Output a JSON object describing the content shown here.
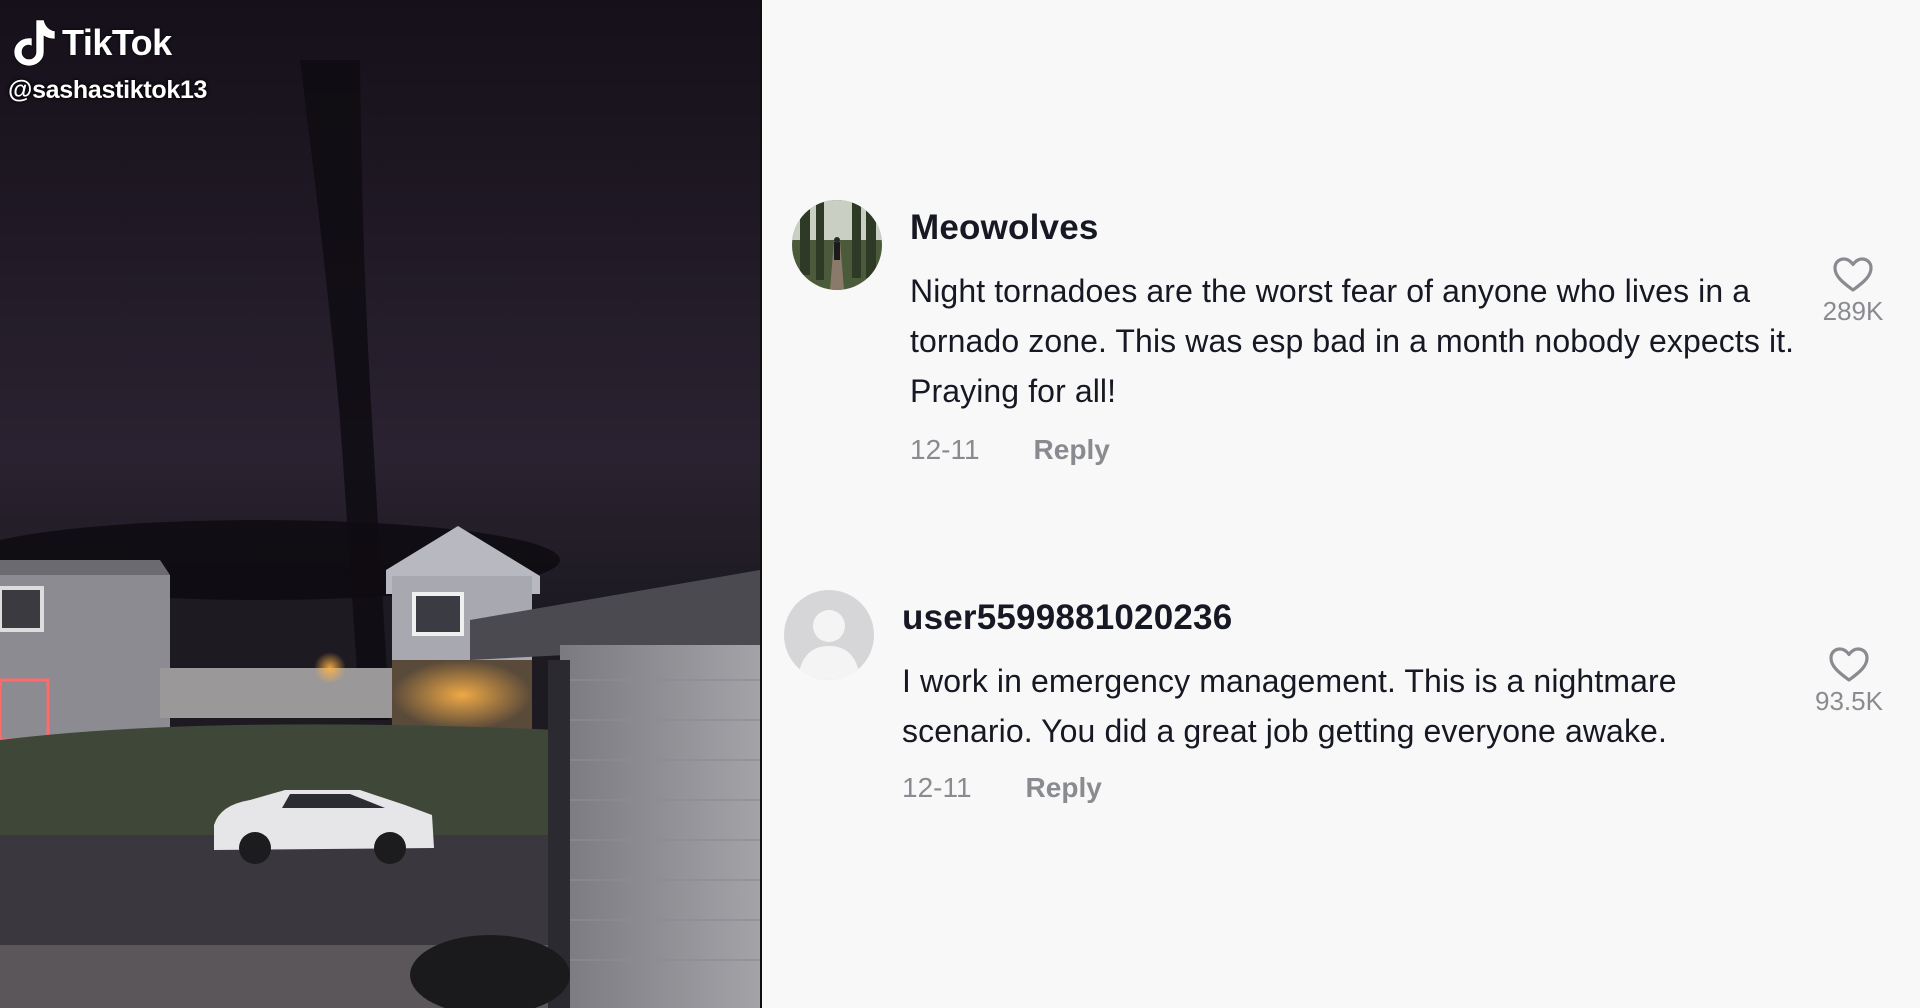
{
  "video": {
    "brand": "TikTok",
    "handle": "@sashastiktok13"
  },
  "comments": [
    {
      "username": "Meowolves",
      "text": "Night tornadoes are the worst fear of anyone who lives in a tornado zone. This was esp bad in a month nobody expects it. Praying for all!",
      "date": "12-11",
      "reply_label": "Reply",
      "likes": "289K",
      "avatar_icon": "forest-photo-avatar"
    },
    {
      "username": "user5599881020236",
      "text": "I work in emergency management. This is a nightmare scenario. You did a great job getting everyone awake.",
      "date": "12-11",
      "reply_label": "Reply",
      "likes": "93.5K",
      "avatar_icon": "default-user-avatar"
    }
  ],
  "icons": {
    "like": "heart-outline-icon",
    "logo": "tiktok-note-icon"
  },
  "colors": {
    "background": "#f8f8f8",
    "text_primary": "#161823",
    "text_secondary": "#8a8b91"
  }
}
